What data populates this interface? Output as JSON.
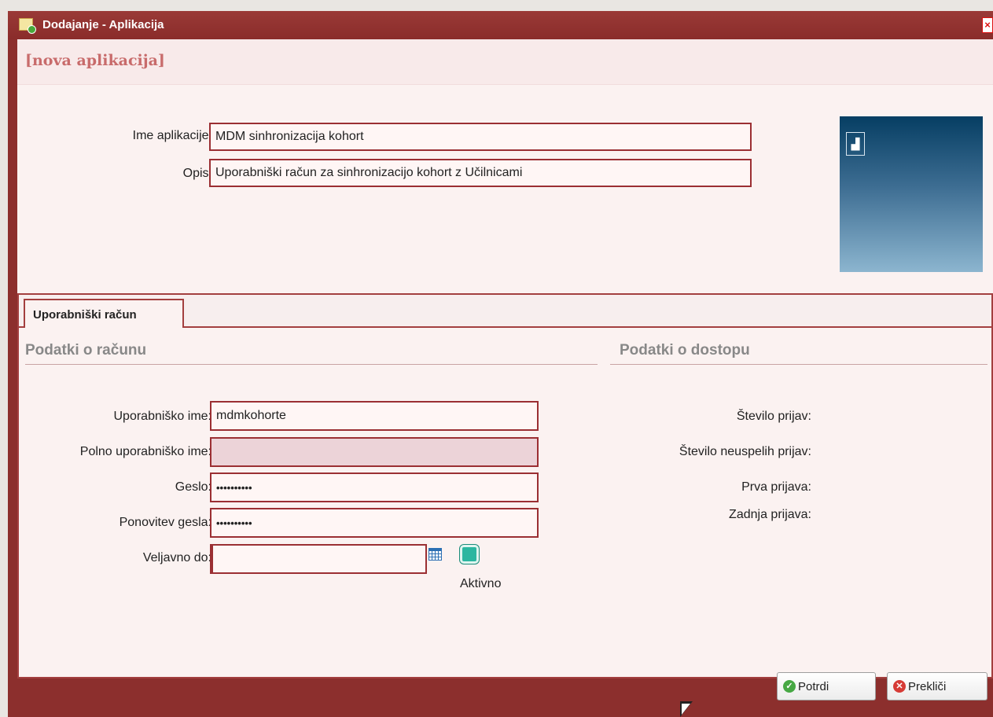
{
  "window": {
    "title": "Dodajanje - Aplikacija"
  },
  "header": {
    "title": "[nova aplikacija]"
  },
  "app_form": {
    "name_label": "Ime aplikacije:",
    "name_value": "MDM sinhronizacija kohort",
    "description_label": "Opis:",
    "description_value": "Uporabniški račun za sinhronizacijo kohort z Učilnicami"
  },
  "tabs": [
    {
      "label": "Uporabniški račun"
    }
  ],
  "account": {
    "section_title": "Podatki o računu",
    "username_label": "Uporabniško ime:",
    "username_value": "mdmkohorte",
    "fullname_label": "Polno uporabniško ime:",
    "fullname_value": "",
    "password_label": "Geslo:",
    "password_value": "••••••••••",
    "password_repeat_label": "Ponovitev gesla:",
    "password_repeat_value": "••••••••••",
    "valid_until_label": "Veljavno do:",
    "valid_until_value": "",
    "active_label": "Aktivno"
  },
  "access": {
    "section_title": "Podatki o dostopu",
    "logins_label": "Število prijav:",
    "failed_logins_label": "Število neuspelih prijav:",
    "first_login_label": "Prva prijava:",
    "last_login_label": "Zadnja prijava:"
  },
  "buttons": {
    "confirm": "Potrdi",
    "cancel": "Prekliči"
  },
  "icons": {
    "title": "app-add-icon",
    "close": "close-icon",
    "image": "image-placeholder-icon",
    "calendar": "calendar-icon",
    "confirm": "check-icon",
    "cancel": "cancel-icon"
  }
}
